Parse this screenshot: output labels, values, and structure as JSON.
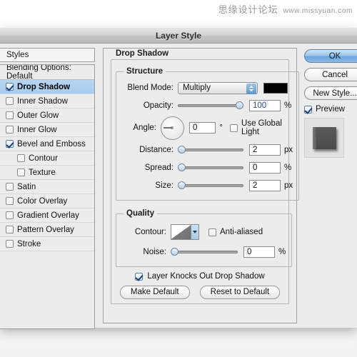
{
  "watermark": {
    "cn": "思缘设计论坛",
    "url": "www.missyuan.com"
  },
  "window": {
    "title": "Layer Style"
  },
  "styles_panel": {
    "header": "Styles",
    "blending_options": "Blending Options: Default",
    "items": [
      {
        "label": "Drop Shadow",
        "checked": true,
        "selected": true,
        "indent": false
      },
      {
        "label": "Inner Shadow",
        "checked": false,
        "selected": false,
        "indent": false
      },
      {
        "label": "Outer Glow",
        "checked": false,
        "selected": false,
        "indent": false
      },
      {
        "label": "Inner Glow",
        "checked": false,
        "selected": false,
        "indent": false
      },
      {
        "label": "Bevel and Emboss",
        "checked": true,
        "selected": false,
        "indent": false
      },
      {
        "label": "Contour",
        "checked": false,
        "selected": false,
        "indent": true
      },
      {
        "label": "Texture",
        "checked": false,
        "selected": false,
        "indent": true
      },
      {
        "label": "Satin",
        "checked": false,
        "selected": false,
        "indent": false
      },
      {
        "label": "Color Overlay",
        "checked": false,
        "selected": false,
        "indent": false
      },
      {
        "label": "Gradient Overlay",
        "checked": false,
        "selected": false,
        "indent": false
      },
      {
        "label": "Pattern Overlay",
        "checked": false,
        "selected": false,
        "indent": false
      },
      {
        "label": "Stroke",
        "checked": false,
        "selected": false,
        "indent": false
      }
    ]
  },
  "effect_panel": {
    "title": "Drop Shadow",
    "structure": {
      "title": "Structure",
      "blend_mode_label": "Blend Mode:",
      "blend_mode_value": "Multiply",
      "shadow_color": "#000000",
      "opacity_label": "Opacity:",
      "opacity_value": "100",
      "opacity_unit": "%",
      "angle_label": "Angle:",
      "angle_value": "0",
      "angle_unit": "°",
      "use_global_light_label": "Use Global Light",
      "use_global_light_checked": false,
      "distance_label": "Distance:",
      "distance_value": "2",
      "distance_unit": "px",
      "spread_label": "Spread:",
      "spread_value": "0",
      "spread_unit": "%",
      "size_label": "Size:",
      "size_value": "2",
      "size_unit": "px"
    },
    "quality": {
      "title": "Quality",
      "contour_label": "Contour:",
      "anti_aliased_label": "Anti-aliased",
      "anti_aliased_checked": false,
      "noise_label": "Noise:",
      "noise_value": "0",
      "noise_unit": "%"
    },
    "knockout_label": "Layer Knocks Out Drop Shadow",
    "knockout_checked": true,
    "make_default_label": "Make Default",
    "reset_default_label": "Reset to Default"
  },
  "actions": {
    "ok_label": "OK",
    "cancel_label": "Cancel",
    "new_style_label": "New Style...",
    "preview_label": "Preview",
    "preview_checked": true
  }
}
